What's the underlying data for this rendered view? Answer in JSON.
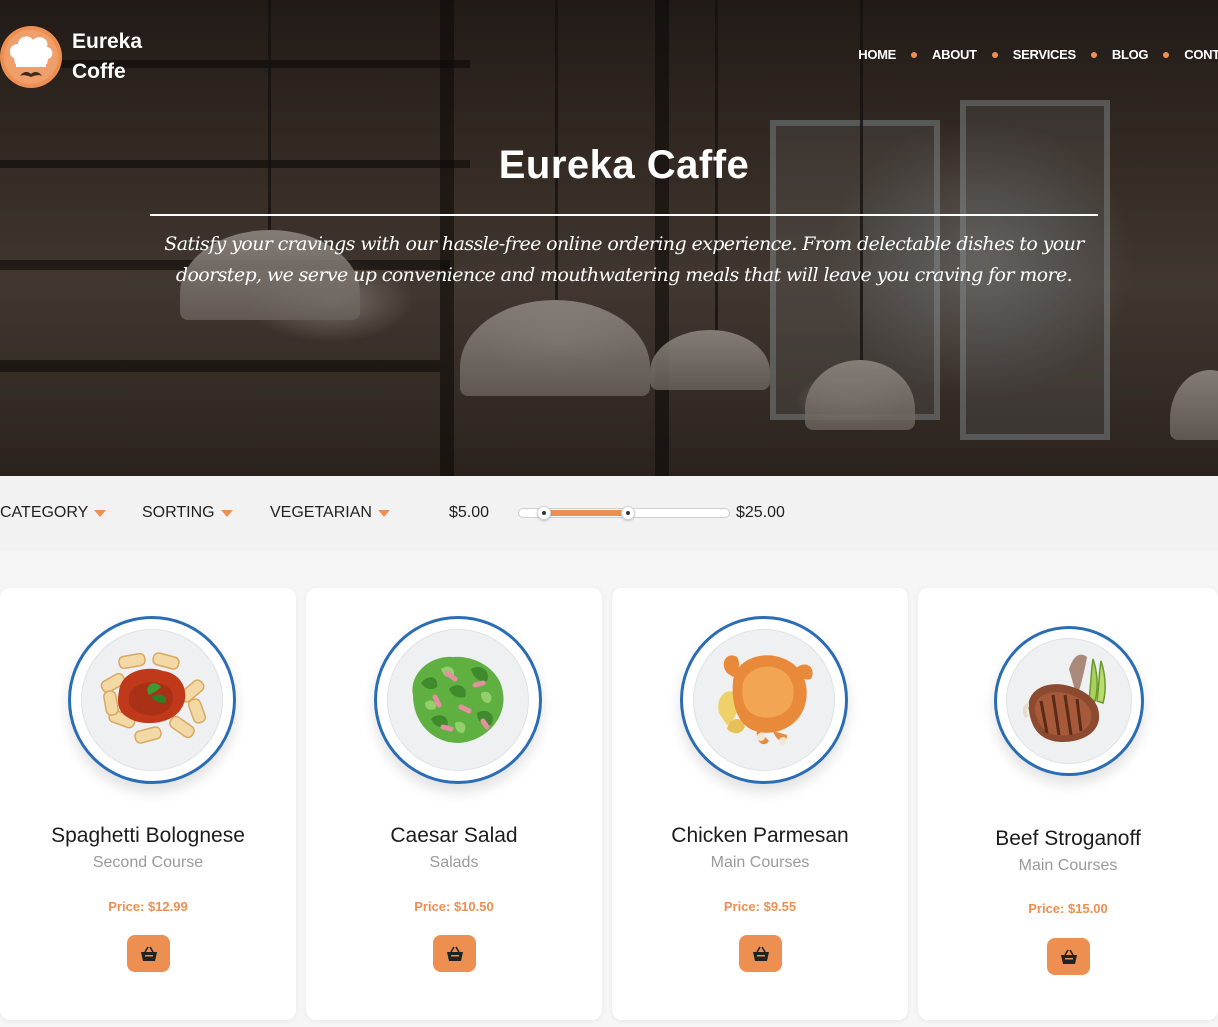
{
  "brand": {
    "line1": "Eureka",
    "line2": "Coffe",
    "logo_icon": "chef-hat-mustache-icon",
    "accent": "#ee8f52"
  },
  "nav": {
    "items": [
      "HOME",
      "ABOUT",
      "SERVICES",
      "BLOG",
      "CONTA"
    ]
  },
  "hero": {
    "title": "Eureka Caffe",
    "tagline": "Satisfy your cravings with our hassle-free online ordering experience. From delectable dishes to your doorstep, we serve up convenience and mouthwatering meals that will leave you craving for more."
  },
  "filters": {
    "category": "CATEGORY",
    "sorting": "SORTING",
    "vegetarian": "VEGETARIAN",
    "price_min": "$5.00",
    "price_max": "$25.00",
    "slider_low_fraction": 0.12,
    "slider_high_fraction": 0.52
  },
  "products": [
    {
      "name": "Spaghetti Bolognese",
      "category": "Second Course",
      "price": "Price: $12.99",
      "image": "pasta-plate"
    },
    {
      "name": "Caesar Salad",
      "category": "Salads",
      "price": "Price: $10.50",
      "image": "salad-plate"
    },
    {
      "name": "Chicken Parmesan",
      "category": "Main Courses",
      "price": "Price: $9.55",
      "image": "roast-chicken-plate"
    },
    {
      "name": "Beef Stroganoff",
      "category": "Main Courses",
      "price": "Price: $15.00",
      "image": "steak-plate"
    }
  ],
  "cart_icon": "basket-icon"
}
